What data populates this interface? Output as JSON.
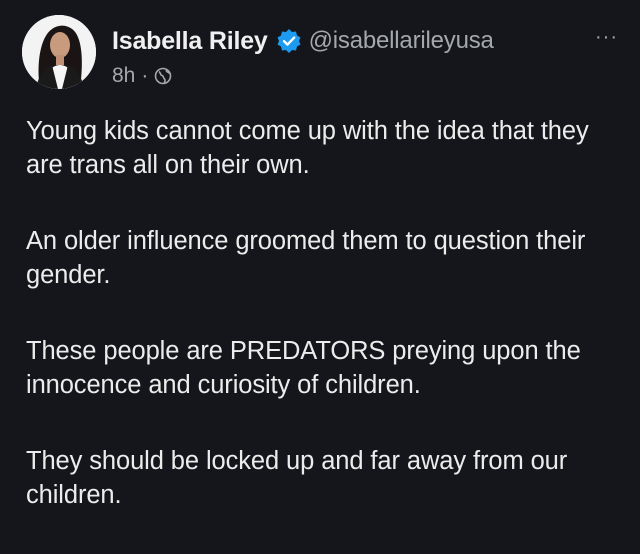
{
  "post": {
    "author": {
      "display_name": "Isabella Riley",
      "handle": "@isabellarileyusa",
      "verified": true,
      "avatar_icon": "profile-photo"
    },
    "time": "8h",
    "separator": "·",
    "visibility_icon": "globe-icon",
    "more_label": "···",
    "paragraphs": [
      "Young kids cannot come up with the idea that they are trans all on their own.",
      "An older influence groomed them to question their gender.",
      "These people are PREDATORS preying upon the innocence and curiosity of children.",
      "They should be locked up and far away from our children."
    ]
  },
  "colors": {
    "background": "#15161b",
    "verified_badge": "#1d9bf0",
    "secondary_text": "#a4a7ac"
  }
}
